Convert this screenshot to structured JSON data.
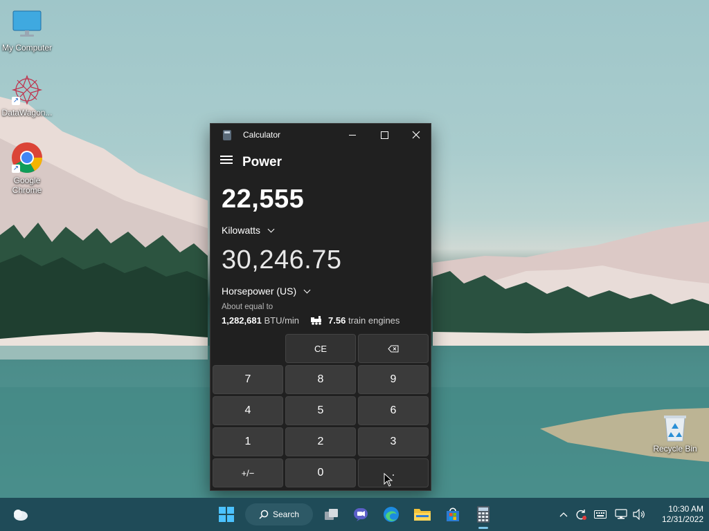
{
  "desktop": {
    "icons": [
      {
        "label": "My Computer"
      },
      {
        "label": "DataWagon..."
      },
      {
        "label": "Google\nChrome"
      },
      {
        "label": "Recycle Bin"
      }
    ]
  },
  "calculator": {
    "window_title": "Calculator",
    "mode": "Power",
    "from": {
      "value": "22,555",
      "unit": "Kilowatts"
    },
    "to": {
      "value": "30,246.75",
      "unit": "Horsepower (US)"
    },
    "about_label": "About equal to",
    "equivalents": [
      {
        "value": "1,282,681",
        "unit": "BTU/min"
      },
      {
        "value": "7.56",
        "unit": "train engines",
        "icon": "train-icon"
      }
    ],
    "keys": {
      "ce": "CE",
      "backspace": "⌫",
      "k7": "7",
      "k8": "8",
      "k9": "9",
      "k4": "4",
      "k5": "5",
      "k6": "6",
      "k1": "1",
      "k2": "2",
      "k3": "3",
      "negate": "+/−",
      "k0": "0",
      "decimal": "."
    }
  },
  "taskbar": {
    "search_label": "Search",
    "clock": {
      "time": "10:30 AM",
      "date": "12/31/2022"
    },
    "accent": "#1f4b58"
  }
}
